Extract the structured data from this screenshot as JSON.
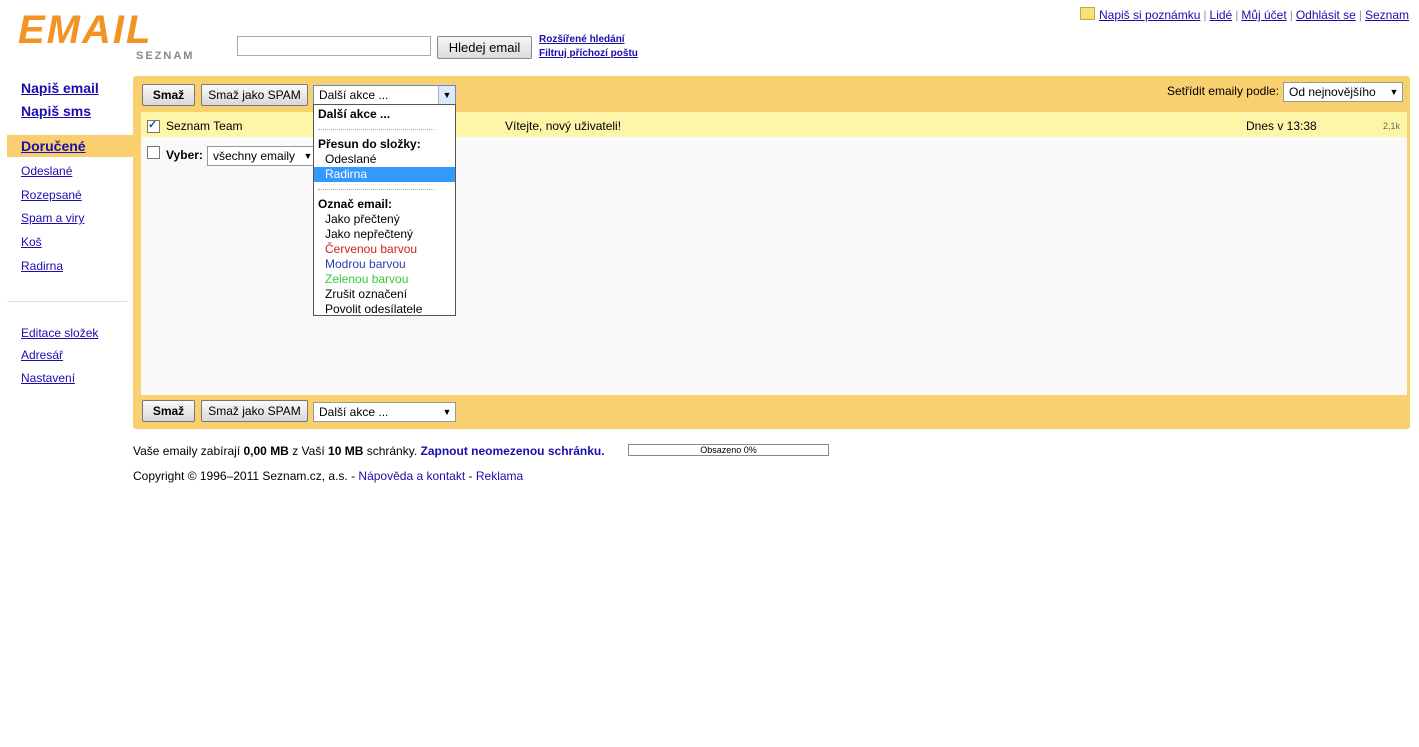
{
  "header": {
    "logo_text": "EMAIL",
    "logo_sub": "SEZNAM",
    "search_placeholder": "",
    "search_button": "Hledej email",
    "advanced_search": "Rozšířené hledání",
    "filter_mail": "Filtruj příchozí poštu",
    "topnav": {
      "note": "Napiš si poznámku",
      "people": "Lidé",
      "account": "Můj účet",
      "logout": "Odhlásit se",
      "seznam": "Seznam"
    }
  },
  "sidebar": {
    "write_email": "Napiš email",
    "write_sms": "Napiš sms",
    "inbox": "Doručené",
    "folders": [
      "Odeslané",
      "Rozepsané",
      "Spam a viry",
      "Koš",
      "Radirna"
    ],
    "tools": [
      "Editace složek",
      "Adresář",
      "Nastavení"
    ]
  },
  "toolbar": {
    "delete": "Smaž",
    "delete_spam": "Smaž jako SPAM",
    "more_actions": "Další akce ...",
    "sort_label": "Setřídit emaily podle:",
    "sort_value": "Od nejnovějšího"
  },
  "messages": [
    {
      "sender": "Seznam Team",
      "subject": "Vítejte, nový uživateli!",
      "date": "Dnes v 13:38",
      "size": "2,1k",
      "checked": true
    }
  ],
  "select_row": {
    "label": "Vyber:",
    "value": "všechny emaily"
  },
  "dropdown": {
    "header": "Další akce ...",
    "move_group": "Přesun do složky:",
    "move_options": [
      "Odeslané",
      "Radirna"
    ],
    "highlighted": "Radirna",
    "mark_group": "Označ email:",
    "mark_options": [
      {
        "label": "Jako přečtený",
        "color": "#000000"
      },
      {
        "label": "Jako nepřečtený",
        "color": "#000000"
      },
      {
        "label": "Červenou barvou",
        "color": "#d42020"
      },
      {
        "label": "Modrou barvou",
        "color": "#2a3fb0"
      },
      {
        "label": "Zelenou barvou",
        "color": "#33cc33"
      },
      {
        "label": "Zrušit označení",
        "color": "#000000"
      },
      {
        "label": "Povolit odesílatele",
        "color": "#000000"
      }
    ]
  },
  "storage": {
    "text_before": "Vaše emaily zabírají",
    "used": "0,00 MB",
    "text_mid": "z Vaší",
    "total": "10 MB",
    "text_after": "schránky.",
    "unlimited_link": "Zapnout neomezenou schránku.",
    "bar_label": "Obsazeno 0%",
    "percent": 0
  },
  "footer": {
    "copyright": "Copyright © 1996–2011 Seznam.cz, a.s. -",
    "help": "Nápověda a kontakt",
    "dash": "-",
    "ads": "Reklama"
  },
  "colors": {
    "accent": "#f8d070",
    "selected_row": "#fdf6a8",
    "logo": "#f39323",
    "highlight": "#3399ff"
  }
}
